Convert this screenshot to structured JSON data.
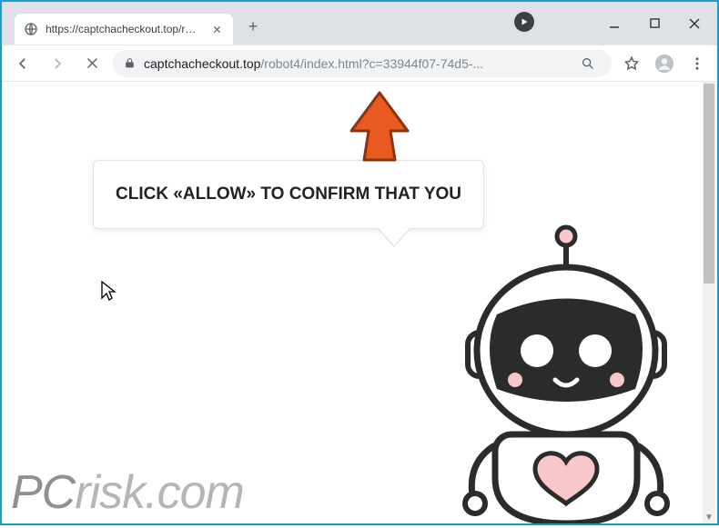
{
  "window": {
    "minimize_label": "Minimize",
    "maximize_label": "Maximize",
    "close_label": "Close"
  },
  "tabs": {
    "active": {
      "title": "https://captchacheckout.top/robo"
    },
    "new_tab_label": "+"
  },
  "addressbar": {
    "nav": {
      "back_label": "Back",
      "forward_label": "Forward",
      "stop_label": "Stop"
    },
    "secure_label": "Secure",
    "url_domain": "captchacheckout.top",
    "url_path": "/robot4/index.html?c=33944f07-74d5-...",
    "search_label": "Search",
    "star_label": "Bookmark",
    "profile_label": "Profile",
    "menu_label": "Menu"
  },
  "page": {
    "bubble_text": "CLICK «ALLOW» TO CONFIRM THAT YOU"
  },
  "watermark": {
    "text_prefix": "PC",
    "text_suffix": "risk.com"
  }
}
